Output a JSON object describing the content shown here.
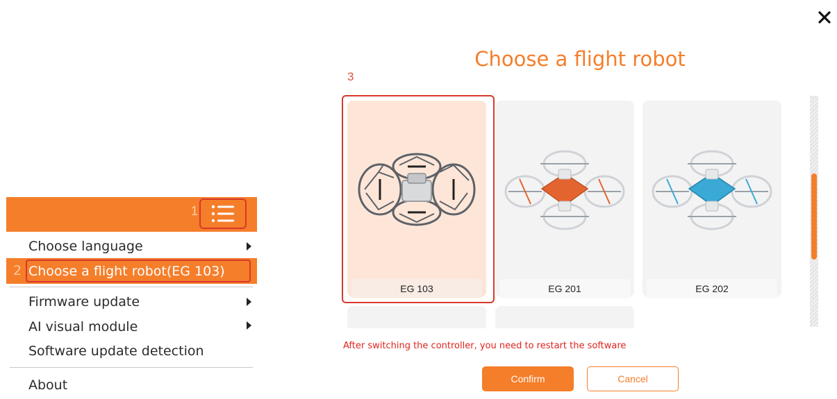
{
  "window": {
    "close_icon": "close-icon"
  },
  "menu": {
    "header_step": "1",
    "header_icon": "list-menu-icon",
    "items": [
      {
        "label": "Choose language",
        "has_submenu": true
      },
      {
        "label": "Choose a flight robot(EG 103)",
        "has_submenu": false,
        "selected": true,
        "step": "2"
      },
      {
        "label": "Firmware update",
        "has_submenu": true
      },
      {
        "label": "AI visual module",
        "has_submenu": true
      },
      {
        "label": "Software update detection",
        "has_submenu": false
      },
      {
        "label": "About",
        "has_submenu": false
      }
    ]
  },
  "panel": {
    "title": "Choose a flight robot",
    "step": "3",
    "robots": [
      {
        "name": "EG 103",
        "selected": true,
        "color": "#6b6f75"
      },
      {
        "name": "EG 201",
        "selected": false,
        "color": "#e4642f"
      },
      {
        "name": "EG 202",
        "selected": false,
        "color": "#3aa9d6"
      }
    ],
    "warning": "After switching the controller, you need to restart the software",
    "confirm_label": "Confirm",
    "cancel_label": "Cancel"
  },
  "scroll": {
    "position_fraction": 0.34
  },
  "colors": {
    "accent": "#f57e2a",
    "highlight": "#d8382c",
    "warning": "#e0241e"
  }
}
